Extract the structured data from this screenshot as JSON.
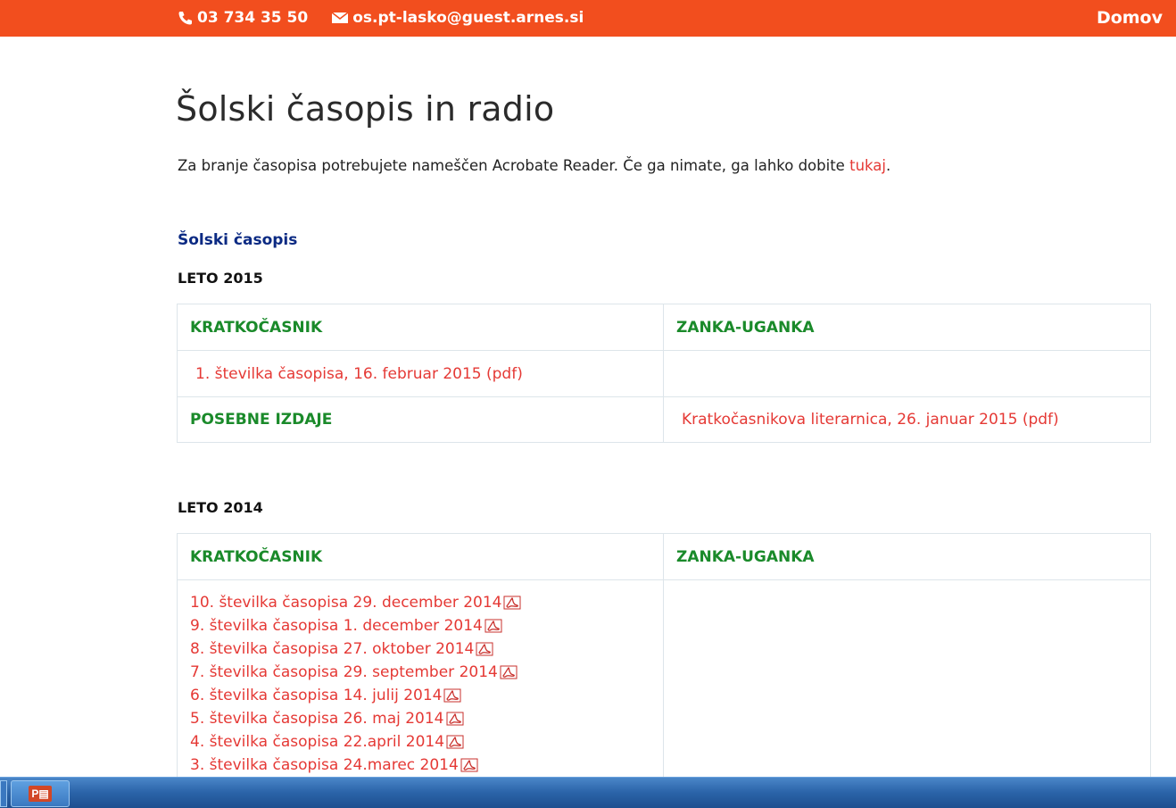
{
  "header": {
    "phone": "03 734 35 50",
    "email": "os.pt-lasko@guest.arnes.si",
    "nav_home": "Domov"
  },
  "page": {
    "title": "Šolski časopis in radio",
    "intro_text": "Za branje časopisa potrebujete nameščen Acrobate Reader. Če ga nimate, ga lahko dobite ",
    "intro_link": "tukaj",
    "intro_end": ".",
    "section_title": "Šolski časopis"
  },
  "year2015": {
    "label": "LETO 2015",
    "col1_header": "KRATKOČASNIK",
    "col2_header": "ZANKA-UGANKA",
    "issue": "1. številka časopisa, 16. februar 2015 (pdf)",
    "special_label": "POSEBNE IZDAJE",
    "special_link": "Kratkočasnikova literarnica, 26. januar 2015 (pdf)"
  },
  "year2014": {
    "label": "LETO 2014",
    "col1_header": "KRATKOČASNIK",
    "col2_header": "ZANKA-UGANKA",
    "issues": [
      "10. številka časopisa 29. december 2014",
      "9. številka časopisa 1. december 2014",
      "8. številka časopisa 27. oktober 2014",
      "7. številka časopisa 29. september 2014",
      "6. številka časopisa 14. julij 2014",
      "5. številka časopisa 26. maj 2014 ",
      "4. številka časopisa 22.april 2014 ",
      "3. številka časopisa 24.marec 2014 "
    ]
  },
  "taskbar": {
    "app_label": "P"
  },
  "colors": {
    "header_bg": "#f24e1e",
    "link": "#e53935",
    "table_header": "#1a8a2a",
    "section_title": "#0b2a83"
  }
}
